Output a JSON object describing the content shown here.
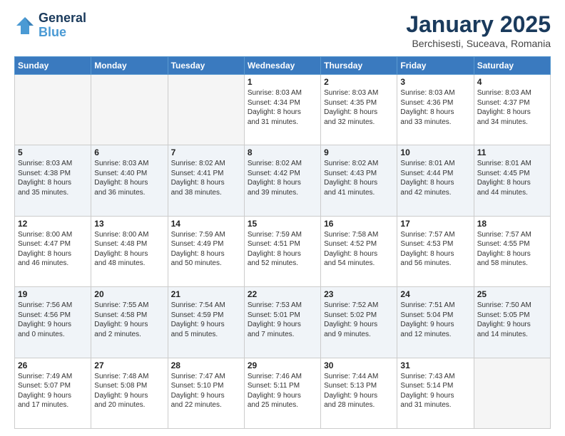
{
  "header": {
    "logo_line1": "General",
    "logo_line2": "Blue",
    "month": "January 2025",
    "location": "Berchisesti, Suceava, Romania"
  },
  "days_of_week": [
    "Sunday",
    "Monday",
    "Tuesday",
    "Wednesday",
    "Thursday",
    "Friday",
    "Saturday"
  ],
  "weeks": [
    [
      {
        "day": "",
        "info": ""
      },
      {
        "day": "",
        "info": ""
      },
      {
        "day": "",
        "info": ""
      },
      {
        "day": "1",
        "info": "Sunrise: 8:03 AM\nSunset: 4:34 PM\nDaylight: 8 hours\nand 31 minutes."
      },
      {
        "day": "2",
        "info": "Sunrise: 8:03 AM\nSunset: 4:35 PM\nDaylight: 8 hours\nand 32 minutes."
      },
      {
        "day": "3",
        "info": "Sunrise: 8:03 AM\nSunset: 4:36 PM\nDaylight: 8 hours\nand 33 minutes."
      },
      {
        "day": "4",
        "info": "Sunrise: 8:03 AM\nSunset: 4:37 PM\nDaylight: 8 hours\nand 34 minutes."
      }
    ],
    [
      {
        "day": "5",
        "info": "Sunrise: 8:03 AM\nSunset: 4:38 PM\nDaylight: 8 hours\nand 35 minutes."
      },
      {
        "day": "6",
        "info": "Sunrise: 8:03 AM\nSunset: 4:40 PM\nDaylight: 8 hours\nand 36 minutes."
      },
      {
        "day": "7",
        "info": "Sunrise: 8:02 AM\nSunset: 4:41 PM\nDaylight: 8 hours\nand 38 minutes."
      },
      {
        "day": "8",
        "info": "Sunrise: 8:02 AM\nSunset: 4:42 PM\nDaylight: 8 hours\nand 39 minutes."
      },
      {
        "day": "9",
        "info": "Sunrise: 8:02 AM\nSunset: 4:43 PM\nDaylight: 8 hours\nand 41 minutes."
      },
      {
        "day": "10",
        "info": "Sunrise: 8:01 AM\nSunset: 4:44 PM\nDaylight: 8 hours\nand 42 minutes."
      },
      {
        "day": "11",
        "info": "Sunrise: 8:01 AM\nSunset: 4:45 PM\nDaylight: 8 hours\nand 44 minutes."
      }
    ],
    [
      {
        "day": "12",
        "info": "Sunrise: 8:00 AM\nSunset: 4:47 PM\nDaylight: 8 hours\nand 46 minutes."
      },
      {
        "day": "13",
        "info": "Sunrise: 8:00 AM\nSunset: 4:48 PM\nDaylight: 8 hours\nand 48 minutes."
      },
      {
        "day": "14",
        "info": "Sunrise: 7:59 AM\nSunset: 4:49 PM\nDaylight: 8 hours\nand 50 minutes."
      },
      {
        "day": "15",
        "info": "Sunrise: 7:59 AM\nSunset: 4:51 PM\nDaylight: 8 hours\nand 52 minutes."
      },
      {
        "day": "16",
        "info": "Sunrise: 7:58 AM\nSunset: 4:52 PM\nDaylight: 8 hours\nand 54 minutes."
      },
      {
        "day": "17",
        "info": "Sunrise: 7:57 AM\nSunset: 4:53 PM\nDaylight: 8 hours\nand 56 minutes."
      },
      {
        "day": "18",
        "info": "Sunrise: 7:57 AM\nSunset: 4:55 PM\nDaylight: 8 hours\nand 58 minutes."
      }
    ],
    [
      {
        "day": "19",
        "info": "Sunrise: 7:56 AM\nSunset: 4:56 PM\nDaylight: 9 hours\nand 0 minutes."
      },
      {
        "day": "20",
        "info": "Sunrise: 7:55 AM\nSunset: 4:58 PM\nDaylight: 9 hours\nand 2 minutes."
      },
      {
        "day": "21",
        "info": "Sunrise: 7:54 AM\nSunset: 4:59 PM\nDaylight: 9 hours\nand 5 minutes."
      },
      {
        "day": "22",
        "info": "Sunrise: 7:53 AM\nSunset: 5:01 PM\nDaylight: 9 hours\nand 7 minutes."
      },
      {
        "day": "23",
        "info": "Sunrise: 7:52 AM\nSunset: 5:02 PM\nDaylight: 9 hours\nand 9 minutes."
      },
      {
        "day": "24",
        "info": "Sunrise: 7:51 AM\nSunset: 5:04 PM\nDaylight: 9 hours\nand 12 minutes."
      },
      {
        "day": "25",
        "info": "Sunrise: 7:50 AM\nSunset: 5:05 PM\nDaylight: 9 hours\nand 14 minutes."
      }
    ],
    [
      {
        "day": "26",
        "info": "Sunrise: 7:49 AM\nSunset: 5:07 PM\nDaylight: 9 hours\nand 17 minutes."
      },
      {
        "day": "27",
        "info": "Sunrise: 7:48 AM\nSunset: 5:08 PM\nDaylight: 9 hours\nand 20 minutes."
      },
      {
        "day": "28",
        "info": "Sunrise: 7:47 AM\nSunset: 5:10 PM\nDaylight: 9 hours\nand 22 minutes."
      },
      {
        "day": "29",
        "info": "Sunrise: 7:46 AM\nSunset: 5:11 PM\nDaylight: 9 hours\nand 25 minutes."
      },
      {
        "day": "30",
        "info": "Sunrise: 7:44 AM\nSunset: 5:13 PM\nDaylight: 9 hours\nand 28 minutes."
      },
      {
        "day": "31",
        "info": "Sunrise: 7:43 AM\nSunset: 5:14 PM\nDaylight: 9 hours\nand 31 minutes."
      },
      {
        "day": "",
        "info": ""
      }
    ]
  ]
}
